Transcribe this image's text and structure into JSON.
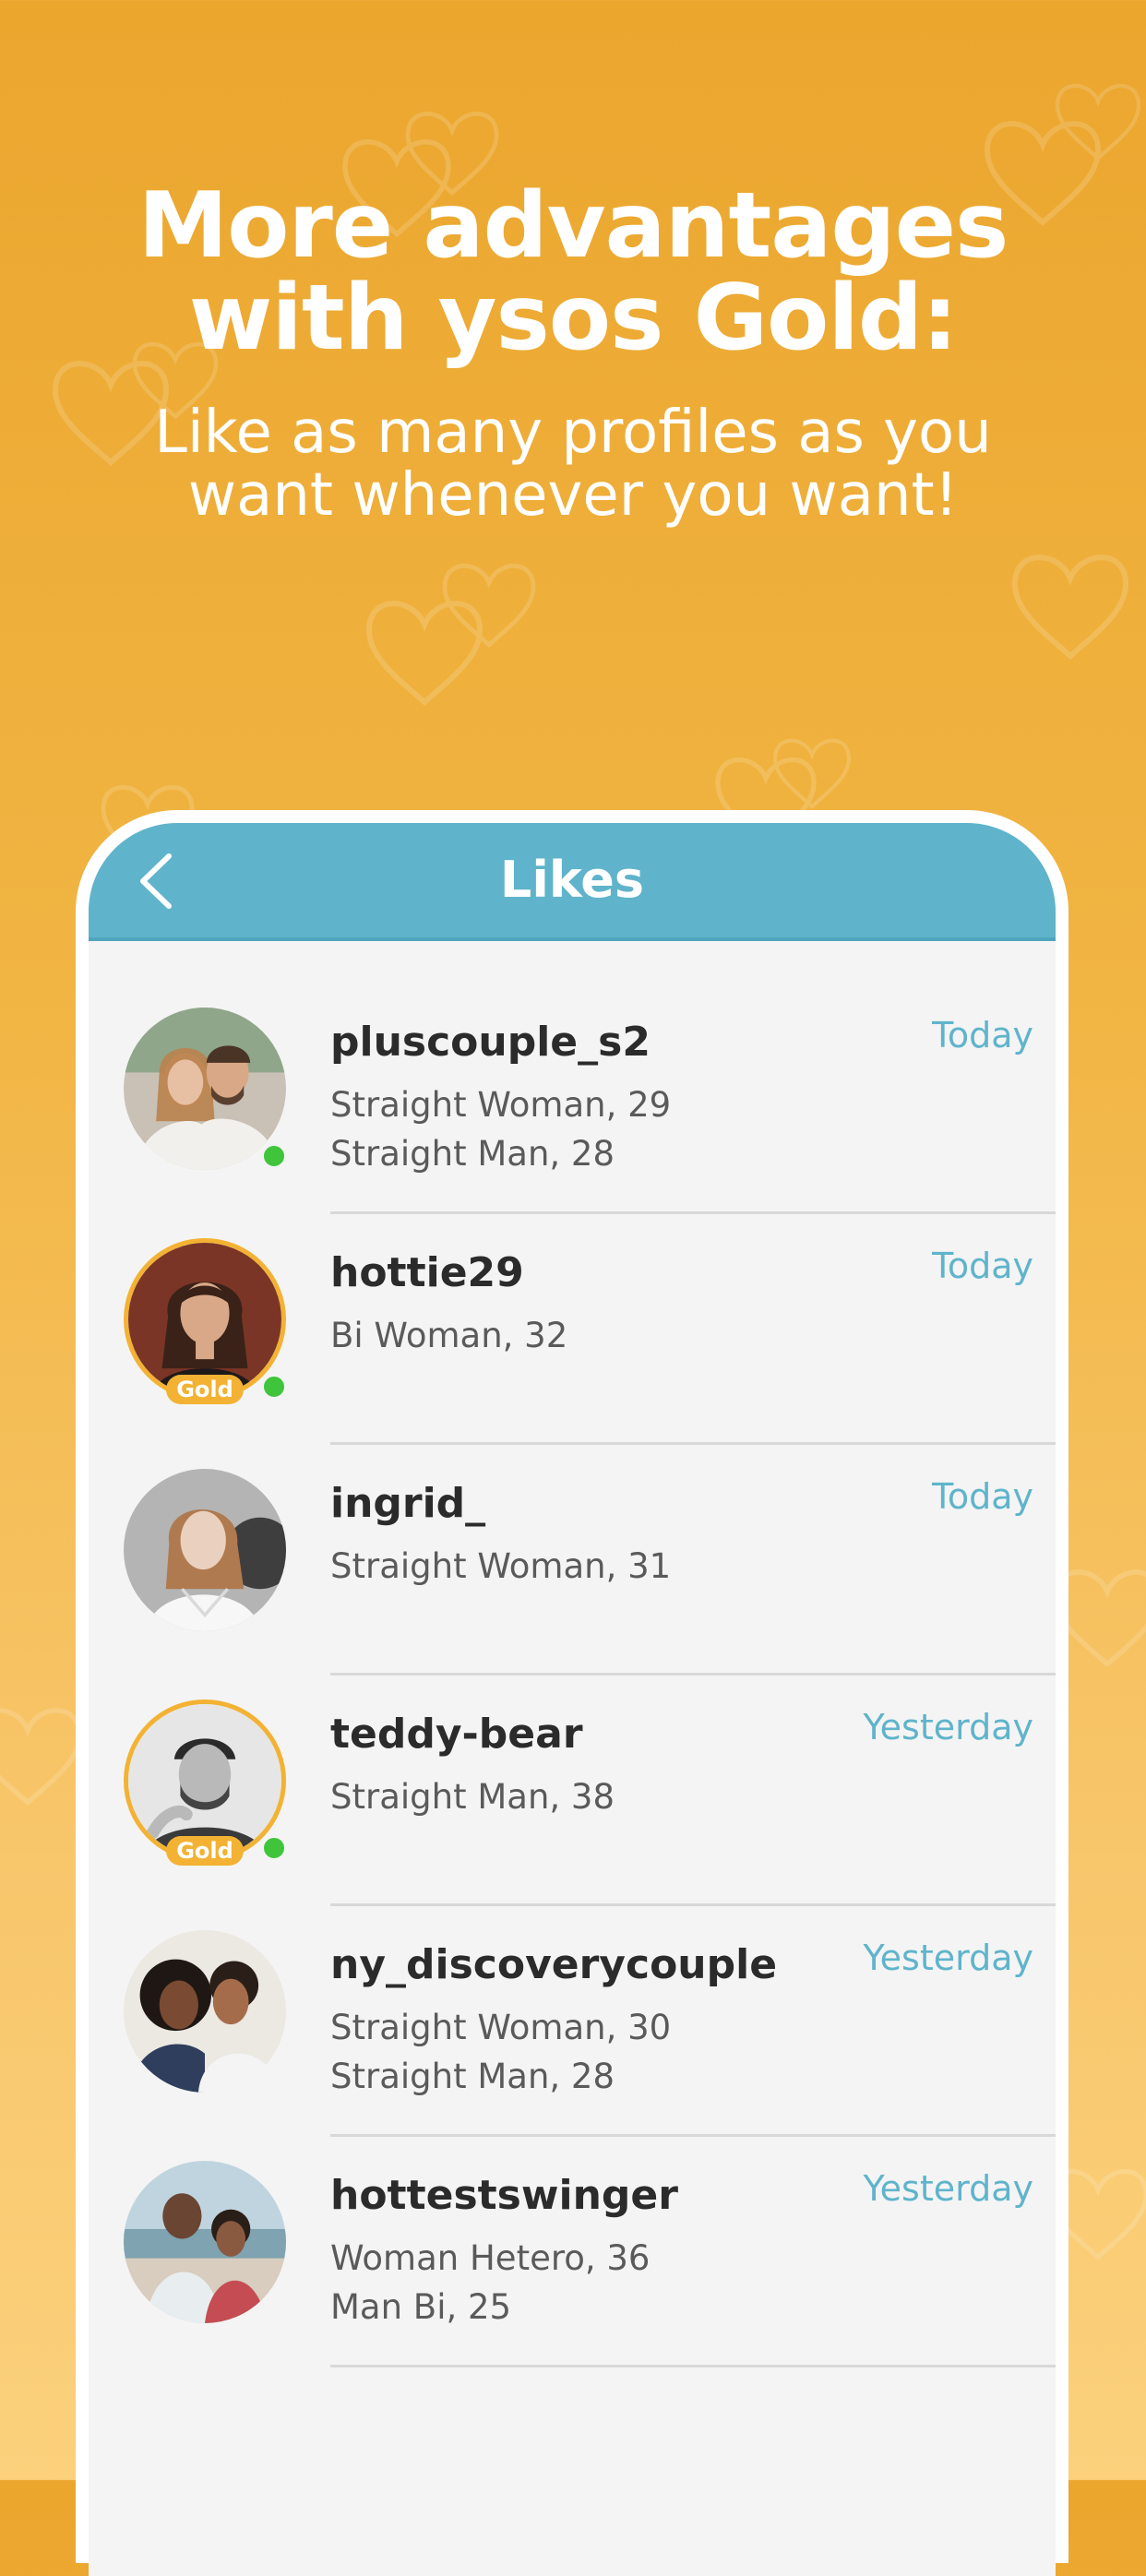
{
  "hero": {
    "title_line1": "More advantages",
    "title_line2": "with ysos Gold:",
    "subtitle_line1": "Like as many profiles as you",
    "subtitle_line2": "want whenever you want!"
  },
  "appbar": {
    "title": "Likes",
    "back_icon": "chevron-left-icon"
  },
  "colors": {
    "background_top": "#EBA62E",
    "background_bottom": "#FBD17C",
    "header": "#5FB4CB",
    "time_text": "#5FB4CB",
    "gold": "#F3B233",
    "online": "#3FC43C"
  },
  "likes": [
    {
      "username": "pluscouple_s2",
      "line1": "Straight Woman, 29",
      "line2": "Straight Man, 28",
      "time": "Today",
      "gold": false,
      "online": true
    },
    {
      "username": "hottie29",
      "line1": "Bi Woman, 32",
      "line2": "",
      "time": "Today",
      "gold": true,
      "gold_label": "Gold",
      "online": true
    },
    {
      "username": "ingrid_",
      "line1": "Straight Woman, 31",
      "line2": "",
      "time": "Today",
      "gold": false,
      "online": false
    },
    {
      "username": "teddy-bear",
      "line1": "Straight Man, 38",
      "line2": "",
      "time": "Yesterday",
      "gold": true,
      "gold_label": "Gold",
      "online": true
    },
    {
      "username": "ny_discoverycouple",
      "line1": "Straight Woman, 30",
      "line2": "Straight Man, 28",
      "time": "Yesterday",
      "gold": false,
      "online": false
    },
    {
      "username": "hottestswinger",
      "line1": "Woman Hetero, 36",
      "line2": "Man Bi, 25",
      "time": "Yesterday",
      "gold": false,
      "online": false
    }
  ]
}
